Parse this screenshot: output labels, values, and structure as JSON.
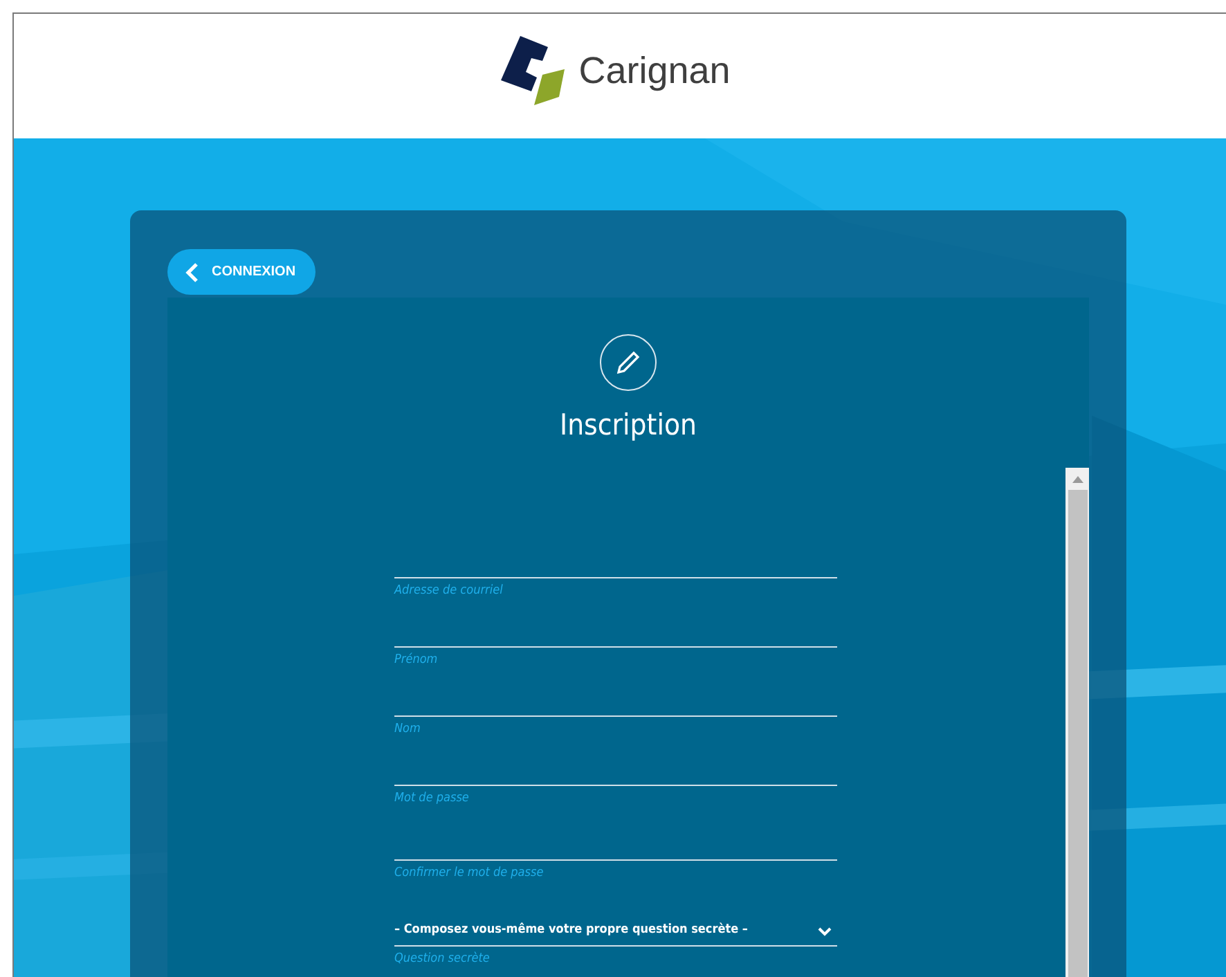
{
  "header": {
    "logo_text": "Carignan"
  },
  "back_button": {
    "label": "CONNEXION"
  },
  "form": {
    "title": "Inscription",
    "fields": [
      {
        "kind": "input",
        "label": "Adresse de courriel"
      },
      {
        "kind": "input",
        "label": "Prénom"
      },
      {
        "kind": "input",
        "label": "Nom"
      },
      {
        "kind": "password",
        "label": "Mot de passe"
      },
      {
        "kind": "password",
        "label": "Confirmer le mot de passe"
      },
      {
        "kind": "select",
        "value": "– Composez vous-même votre propre question secrète –",
        "label": "Question secrète"
      }
    ]
  }
}
